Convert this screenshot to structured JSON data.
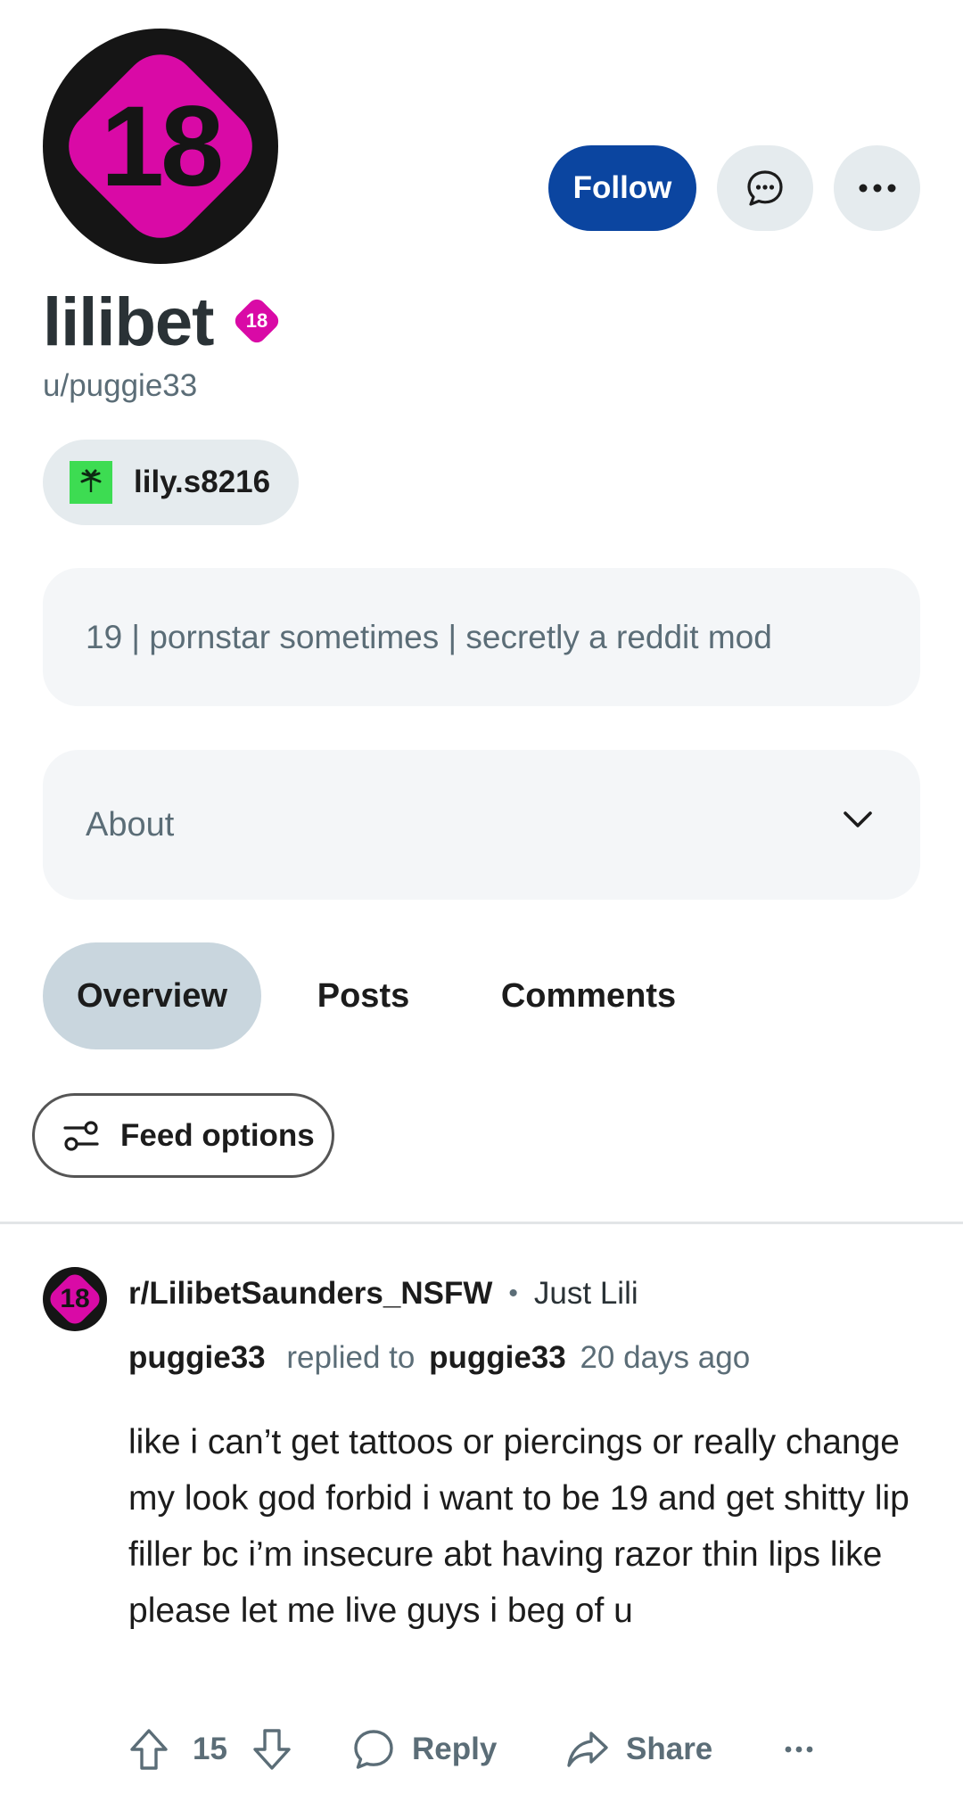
{
  "profile": {
    "avatar_text": "18",
    "display_name": "lilibet",
    "nsfw_badge_text": "18",
    "username": "u/puggie33",
    "social_link": "lily.s8216",
    "bio": "19 | pornstar sometimes | secretly a reddit mod",
    "about_label": "About"
  },
  "actions": {
    "follow_label": "Follow",
    "chat_icon": "chat-bubble-icon",
    "more_icon": "more-horizontal-icon"
  },
  "tabs": [
    {
      "label": "Overview",
      "selected": true
    },
    {
      "label": "Posts",
      "selected": false
    },
    {
      "label": "Comments",
      "selected": false
    }
  ],
  "feed_options": {
    "label": "Feed options"
  },
  "comment": {
    "sub_avatar_text": "18",
    "subreddit": "r/LilibetSaunders_NSFW",
    "separator": "•",
    "flair": "Just Lili",
    "author": "puggie33",
    "replied_to_label": "replied to",
    "parent_author": "puggie33",
    "age": "20 days ago",
    "body": "like i can’t get tattoos or piercings or really change my look god forbid i want to be 19 and get shitty lip filler bc i’m insecure abt having razor thin lips like please let me live guys i beg of u",
    "score": "15",
    "reply_label": "Reply",
    "share_label": "Share"
  },
  "colors": {
    "follow_bg": "#0b45a0",
    "nsfw_pink": "#d90aa6",
    "selected_tab": "#c9d6de",
    "chip_bg": "#e5ebee"
  }
}
